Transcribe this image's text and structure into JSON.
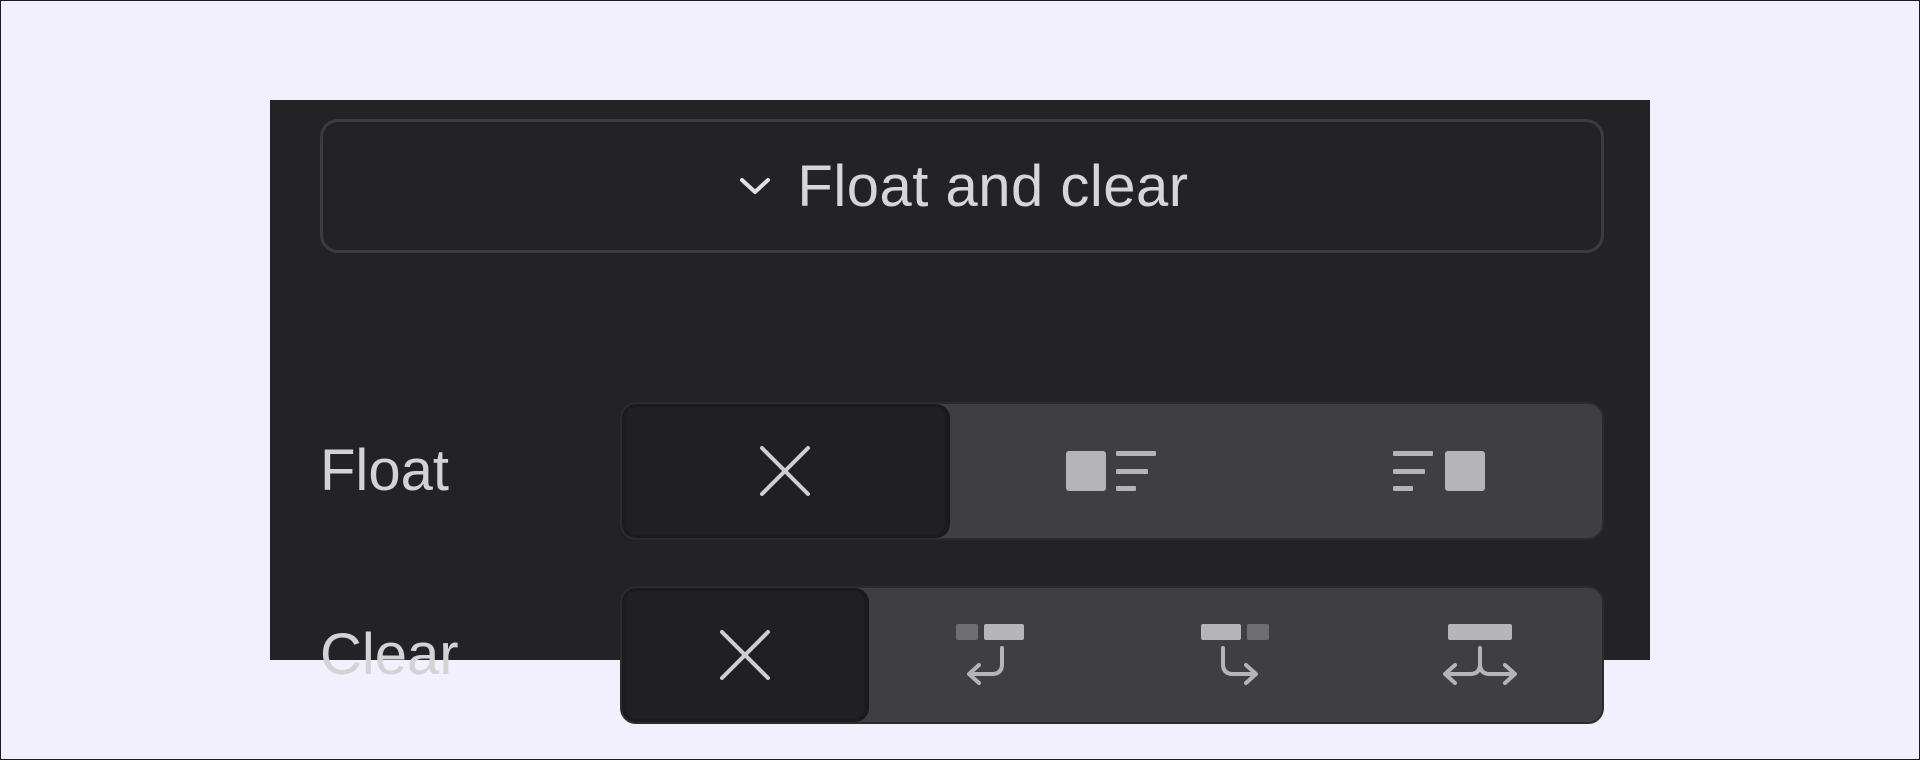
{
  "section": {
    "title": "Float and clear",
    "toggle_icon": "chevron-down-icon"
  },
  "float": {
    "label": "Float",
    "options": [
      {
        "name": "none",
        "icon": "close-icon",
        "selected": true
      },
      {
        "name": "left",
        "icon": "float-left-icon",
        "selected": false
      },
      {
        "name": "right",
        "icon": "float-right-icon",
        "selected": false
      }
    ]
  },
  "clear": {
    "label": "Clear",
    "options": [
      {
        "name": "none",
        "icon": "close-icon",
        "selected": true
      },
      {
        "name": "left",
        "icon": "clear-left-icon",
        "selected": false
      },
      {
        "name": "right",
        "icon": "clear-right-icon",
        "selected": false
      },
      {
        "name": "both",
        "icon": "clear-both-icon",
        "selected": false
      }
    ]
  },
  "colors": {
    "page_background": "#f2f0fd",
    "panel_background": "#232224",
    "segment_background": "#3f3e41",
    "segment_selected": "#201f22",
    "text": "#d6d6d8",
    "icon": "#b5b4b8"
  }
}
